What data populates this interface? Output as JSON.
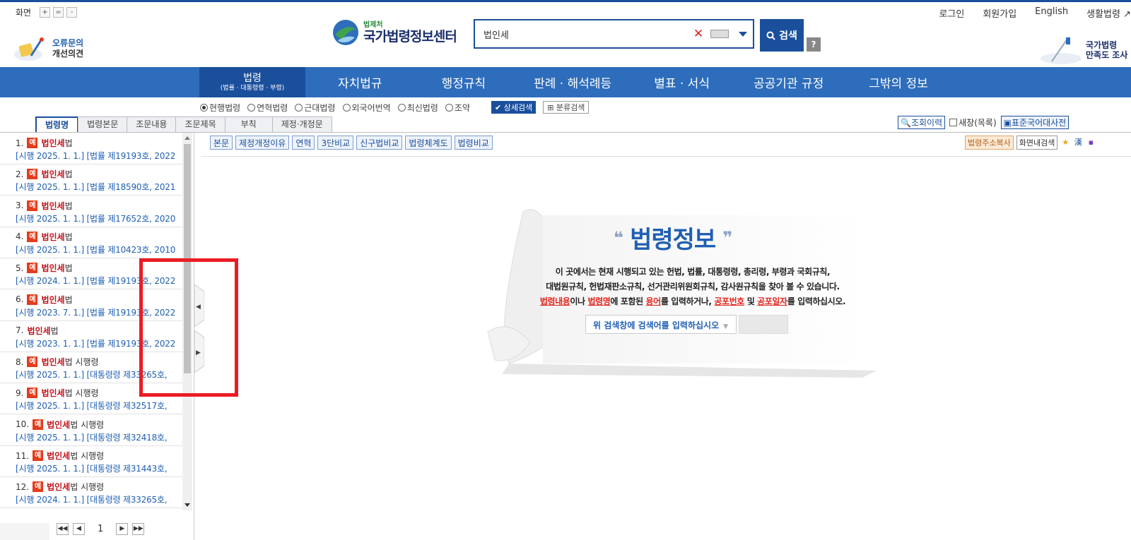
{
  "header": {
    "screen_label": "화면",
    "zoom_in": "+",
    "zoom_reset": "=",
    "zoom_out": "-",
    "top_links": [
      "로그인",
      "회원가입",
      "English",
      "생활법령 ↗"
    ],
    "feedback_line1": "오류문의",
    "feedback_line2": "개선의견",
    "logo_small": "법제처",
    "logo_main": "국가법령정보센터",
    "search_value": "법인세",
    "search_button": "검색",
    "help_button": "?",
    "survey_line1": "국가법령",
    "survey_line2": "만족도 조사"
  },
  "nav": {
    "active_main": "법령",
    "active_sub": "(법률 · 대통령령 · 부령)",
    "items": [
      "자치법규",
      "행정규칙",
      "판례 · 해석례등",
      "별표 · 서식",
      "공공기관 규정",
      "그밖의 정보"
    ]
  },
  "filters": {
    "radios": [
      "현행법령",
      "연혁법령",
      "근대법령",
      "외국어번역",
      "최신법령",
      "조약"
    ],
    "selected": "현행법령",
    "detail_search": "상세검색",
    "class_search": "분류검색"
  },
  "tabs": [
    "법령명",
    "법령본문",
    "조문내용",
    "조문제목",
    "부칙",
    "제정·개정문"
  ],
  "active_tab": "법령명",
  "right_tools": {
    "history": "조회이력",
    "new_window": "새창(목록)",
    "dictionary": "표준국어대사전"
  },
  "list": [
    {
      "num": "1.",
      "badge": "예",
      "hl": "법인세",
      "rest": "법",
      "sub": "[시행 2025. 1. 1.] [법률 제19193호, 2022"
    },
    {
      "num": "2.",
      "badge": "예",
      "hl": "법인세",
      "rest": "법",
      "sub": "[시행 2025. 1. 1.] [법률 제18590호, 2021"
    },
    {
      "num": "3.",
      "badge": "예",
      "hl": "법인세",
      "rest": "법",
      "sub": "[시행 2025. 1. 1.] [법률 제17652호, 2020"
    },
    {
      "num": "4.",
      "badge": "예",
      "hl": "법인세",
      "rest": "법",
      "sub": "[시행 2025. 1. 1.] [법률 제10423호, 2010"
    },
    {
      "num": "5.",
      "badge": "예",
      "hl": "법인세",
      "rest": "법",
      "sub": "[시행 2024. 1. 1.] [법률 제19193호, 2022"
    },
    {
      "num": "6.",
      "badge": "예",
      "hl": "법인세",
      "rest": "법",
      "sub": "[시행 2023. 7. 1.] [법률 제19193호, 2022"
    },
    {
      "num": "7.",
      "badge": "",
      "hl": "법인세",
      "rest": "법",
      "sub": "[시행 2023. 1. 1.] [법률 제19193호, 2022"
    },
    {
      "num": "8.",
      "badge": "예",
      "hl": "법인세",
      "rest": "법 시행령",
      "sub": "[시행 2025. 1. 1.] [대통령령 제33265호,"
    },
    {
      "num": "9.",
      "badge": "예",
      "hl": "법인세",
      "rest": "법 시행령",
      "sub": "[시행 2025. 1. 1.] [대통령령 제32517호,"
    },
    {
      "num": "10.",
      "badge": "예",
      "hl": "법인세",
      "rest": "법 시행령",
      "sub": "[시행 2025. 1. 1.] [대통령령 제32418호,"
    },
    {
      "num": "11.",
      "badge": "예",
      "hl": "법인세",
      "rest": "법 시행령",
      "sub": "[시행 2025. 1. 1.] [대통령령 제31443호,"
    },
    {
      "num": "12.",
      "badge": "예",
      "hl": "법인세",
      "rest": "법 시행령",
      "sub": "[시행 2024. 1. 1.] [대통령령 제33265호,"
    }
  ],
  "pager": {
    "current": "1"
  },
  "toolbar": {
    "buttons": [
      "본문",
      "제정개정이유",
      "연혁",
      "3단비교",
      "신구법비교",
      "법령체계도",
      "법령비교"
    ],
    "copy_address": "법령주소복사",
    "in_page_search": "화면내검색"
  },
  "info": {
    "title": "법령정보",
    "line1": "이 곳에서는 현재 시행되고 있는 헌법, 법률, 대통령령, 총리령, 부령과 국회규칙,",
    "line2": "대법원규칙, 헌법재판소규칙, 선거관리위원회규칙, 감사원규칙을 찾아 볼 수 있습니다.",
    "line3_a": "법령내용",
    "line3_b": "이나 ",
    "line3_c": "법령명",
    "line3_d": "에 포함된 ",
    "line3_e": "용어",
    "line3_f": "를 입력하거나, ",
    "line3_g": "공포번호",
    "line3_h": " 및 ",
    "line3_i": "공포일자",
    "line3_j": "를 입력하십시오.",
    "input_hint": "위 검색창에 검색어를 입력하십시오"
  },
  "colors": {
    "brand": "#1a4f9c",
    "nav": "#2e6dbb",
    "highlight": "#c0141c",
    "annotation": "#ea1c24"
  }
}
